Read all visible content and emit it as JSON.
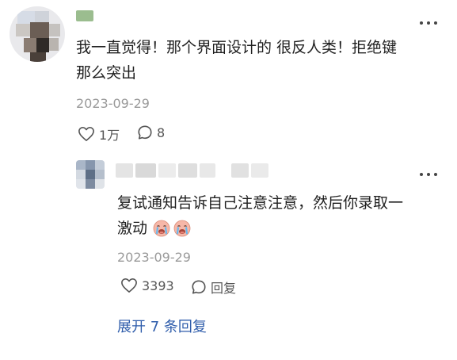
{
  "comment": {
    "text_line1": "我一直觉得！那个界面设计的 很反人类！拒绝键",
    "text_line2": "那么突出",
    "date": "2023-09-29",
    "like_count": "1万",
    "reply_count": "8"
  },
  "reply": {
    "text_line1": "复试通知告诉自己注意注意，然后你录取一",
    "text_line2": "激动",
    "emoji_icon": "crying-face-icon",
    "date": "2023-09-29",
    "like_count": "3393",
    "reply_label": "回复"
  },
  "expand_label": "展开 7 条回复",
  "colors": {
    "link": "#2f5dab",
    "muted": "#9a9a9a"
  }
}
